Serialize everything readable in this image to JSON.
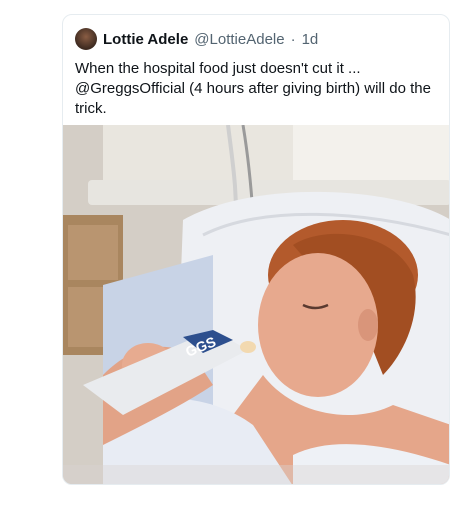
{
  "tweet": {
    "display_name": "Lottie Adele",
    "handle": "@LottieAdele",
    "separator": "·",
    "time": "1d",
    "text": "When the hospital food just doesn't cut it ... @GreggsOfficial (4 hours after giving birth) will do the trick."
  },
  "photo": {
    "bag_text": "GGS"
  },
  "colors": {
    "name": "#0f1419",
    "secondary": "#536471",
    "border": "#e6ecf0"
  }
}
